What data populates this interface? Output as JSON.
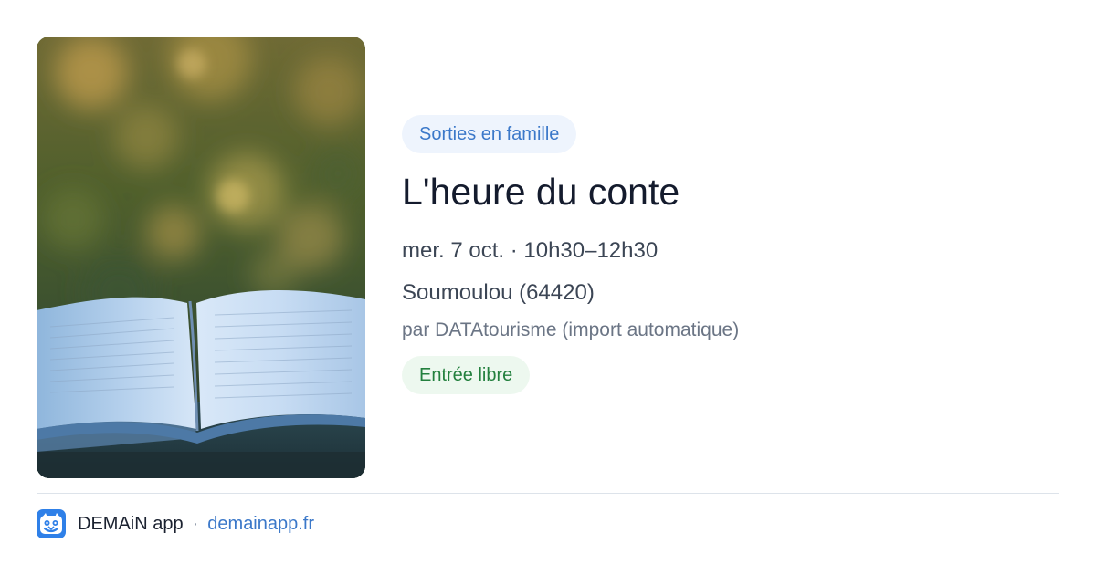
{
  "event": {
    "category": "Sorties en famille",
    "title": "L'heure du conte",
    "datetime": "mer. 7 oct. · 10h30–12h30",
    "location": "Soumoulou (64420)",
    "organizer": "par DATAtourisme (import automatique)",
    "price": "Entrée libre",
    "image_subject": "open-book-photo"
  },
  "footer": {
    "app_name": "DEMAiN app",
    "separator": "·",
    "link": "demainapp.fr"
  },
  "colors": {
    "category_bg": "#eef4fd",
    "category_text": "#3b78c9",
    "price_bg": "#edf8ef",
    "price_text": "#23803e",
    "title": "#141b2d",
    "link": "#3b78c9",
    "logo": "#2f80e8"
  },
  "icons": {
    "app_logo": "demain-logo-icon"
  }
}
